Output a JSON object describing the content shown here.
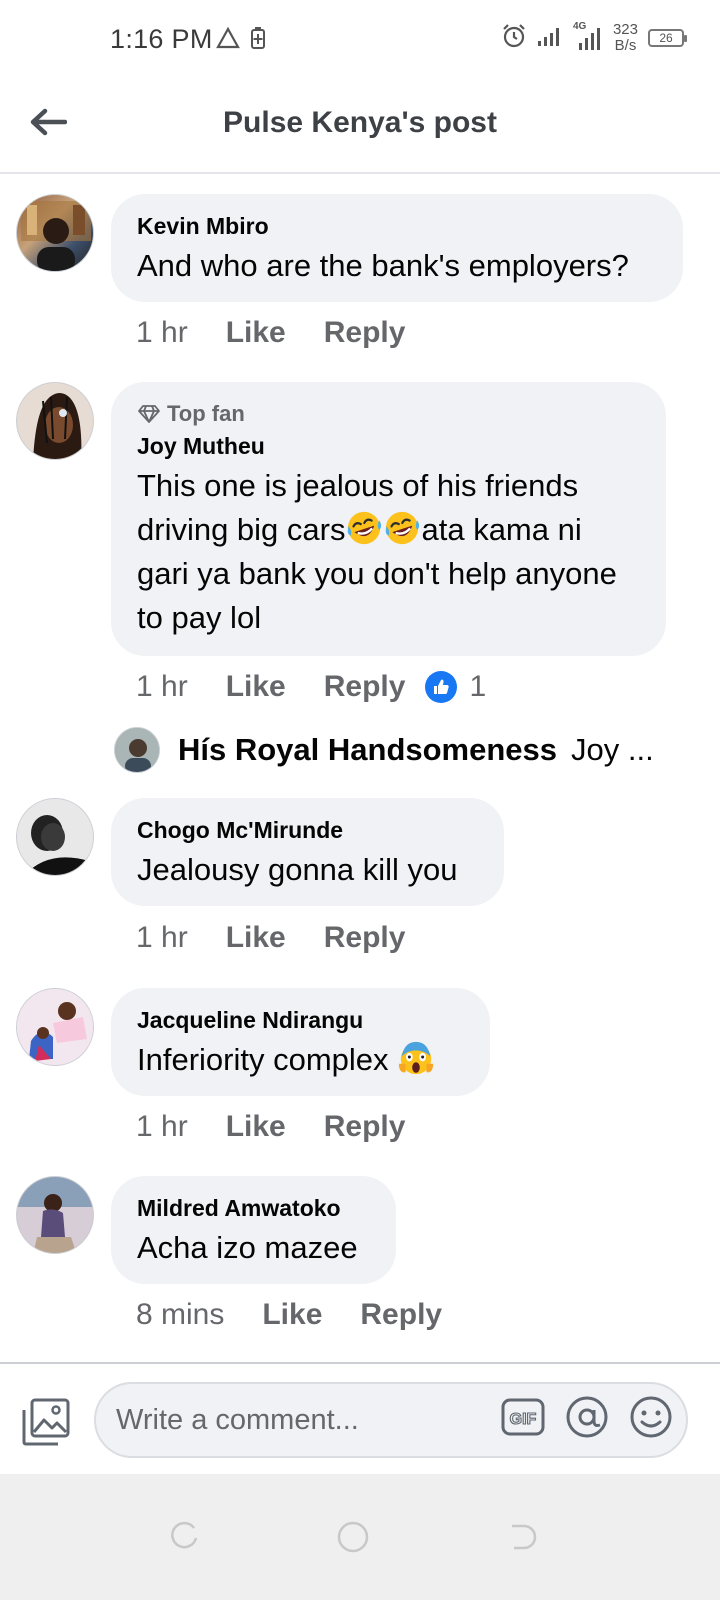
{
  "status_bar": {
    "time": "1:16 PM",
    "network_label": "4G",
    "speed_value": "323",
    "speed_unit": "B/s",
    "battery": "26"
  },
  "header": {
    "title": "Pulse Kenya's post"
  },
  "comments": [
    {
      "author": "Kevin Mbiro",
      "text": "And who are the bank's employers?",
      "time": "1 hr",
      "like_label": "Like",
      "reply_label": "Reply"
    },
    {
      "badge": "Top fan",
      "author": "Joy Mutheu",
      "text_line1": "This one is jealous of his friends",
      "text_line2_start": "driving big cars",
      "text_line2_end": "ata kama ni",
      "text_line3": "gari ya bank you don't help anyone",
      "text_line4": "to pay lol",
      "time": "1 hr",
      "like_label": "Like",
      "reply_label": "Reply",
      "reaction_count": "1",
      "reply_preview": {
        "name": "Hís Royal Handsomeness",
        "text": "Joy ..."
      }
    },
    {
      "author": "Chogo Mc'Mirunde",
      "text": "Jealousy gonna kill you",
      "time": "1 hr",
      "like_label": "Like",
      "reply_label": "Reply"
    },
    {
      "author": "Jacqueline Ndirangu",
      "text": "Inferiority complex",
      "time": "1 hr",
      "like_label": "Like",
      "reply_label": "Reply"
    },
    {
      "author": "Mildred Amwatoko",
      "text": "Acha izo mazee",
      "time": "8 mins",
      "like_label": "Like",
      "reply_label": "Reply"
    }
  ],
  "composer": {
    "placeholder": "Write a comment...",
    "gif_label": "GIF"
  },
  "colors": {
    "bubble": "#f0f2f5",
    "secondary_text": "#65676b",
    "like_blue": "#1877f2"
  },
  "icons": [
    "back-arrow-icon",
    "diamond-icon",
    "laughing-emoji",
    "scream-emoji",
    "like-thumb-icon",
    "photo-icon",
    "gif-icon",
    "mention-icon",
    "emoji-icon"
  ]
}
